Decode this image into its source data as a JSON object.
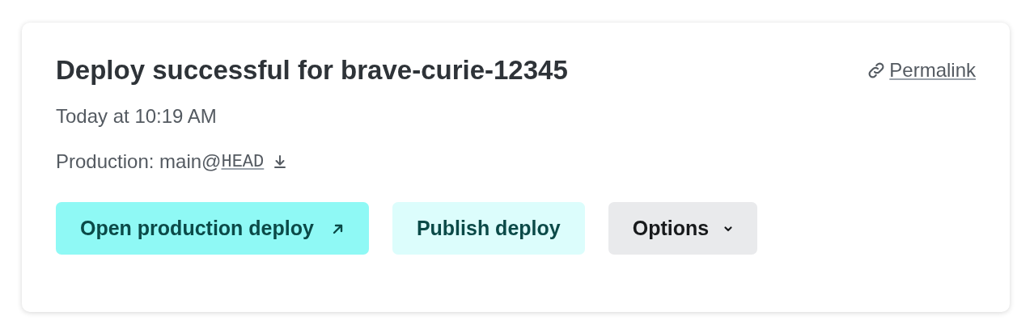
{
  "card": {
    "title": "Deploy successful for brave-curie-12345",
    "permalink": "Permalink",
    "time": "Today at 10:19 AM",
    "source_label": "Production: main@",
    "source_ref": "HEAD",
    "buttons": [
      {
        "label": "Open production deploy",
        "kind": "primary"
      },
      {
        "label": "Publish deploy",
        "kind": "secondary"
      },
      {
        "label": "Options",
        "kind": "neutral"
      }
    ]
  }
}
